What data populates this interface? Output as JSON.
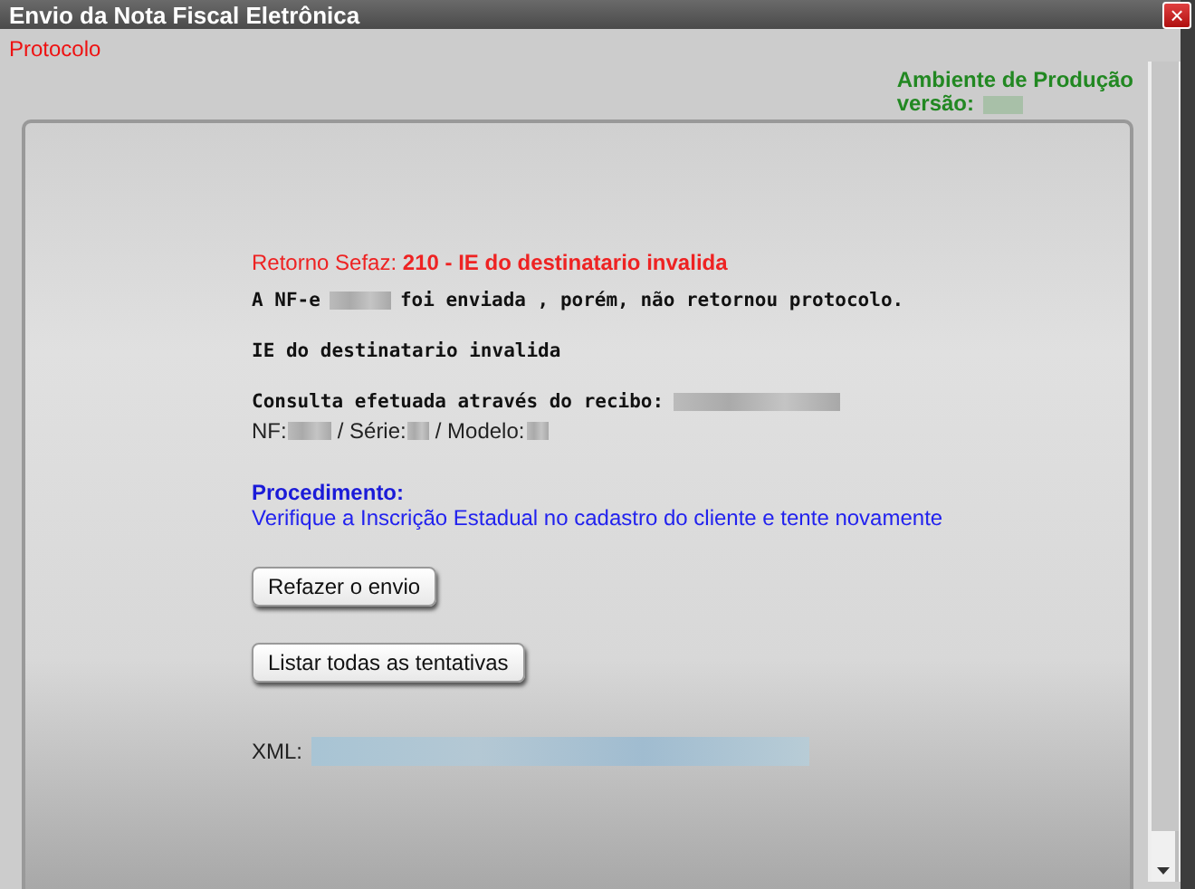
{
  "window": {
    "title": "Envio da Nota Fiscal Eletrônica",
    "close": "×"
  },
  "protocol_label": "Protocolo",
  "environment": {
    "name": "Ambiente de Produção",
    "version_label": "versão:"
  },
  "sefaz_return": "Retorno Sefaz: **210 - IE do destinatario invalida**",
  "sent_message": {
    "before": "A NF-e",
    "after": "foi enviada , porém, não retornou protocolo."
  },
  "error_detail": "IE do destinatario invalida",
  "receipt_label": "Consulta efetuada através do recibo:",
  "invoice_fields": [
    "NF:",
    "/ Série:",
    "/ Modelo:"
  ],
  "procedure": {
    "title": "Procedimento:",
    "text": "Verifique a Inscrição Estadual no cadastro do cliente e tente novamente"
  },
  "buttons": [
    "Refazer o envio",
    "Listar todas as tentativas"
  ],
  "xml_label": "XML:"
}
